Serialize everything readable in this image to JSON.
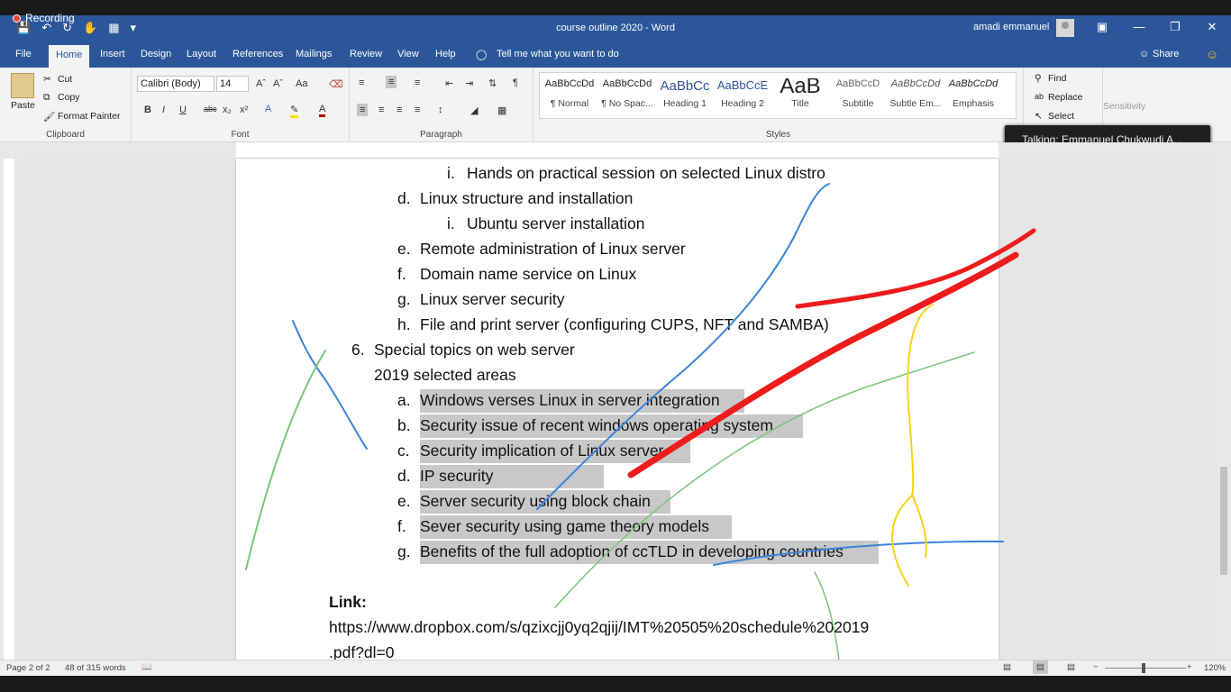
{
  "recording": {
    "label": "Recording"
  },
  "window": {
    "title": "course outline 2020  -  Word",
    "user": "amadi emmanuel"
  },
  "tabs": [
    "File",
    "Home",
    "Insert",
    "Design",
    "Layout",
    "References",
    "Mailings",
    "Review",
    "View",
    "Help"
  ],
  "tell_me": "Tell me what you want to do",
  "share": "Share",
  "clipboard": {
    "paste": "Paste",
    "cut": "Cut",
    "copy": "Copy",
    "format_painter": "Format Painter",
    "label": "Clipboard"
  },
  "font": {
    "name": "Calibri (Body)",
    "size": "14",
    "label": "Font"
  },
  "paragraph": {
    "label": "Paragraph"
  },
  "styles": {
    "label": "Styles",
    "items": [
      {
        "preview": "AaBbCcDd",
        "name": "¶ Normal"
      },
      {
        "preview": "AaBbCcDd",
        "name": "¶ No Spac..."
      },
      {
        "preview": "AaBbCc",
        "name": "Heading 1"
      },
      {
        "preview": "AaBbCcE",
        "name": "Heading 2"
      },
      {
        "preview": "AaB",
        "name": "Title"
      },
      {
        "preview": "AaBbCcD",
        "name": "Subtitle"
      },
      {
        "preview": "AaBbCcDd",
        "name": "Subtle Em..."
      },
      {
        "preview": "AaBbCcDd",
        "name": "Emphasis"
      }
    ]
  },
  "editing": {
    "find": "Find",
    "replace": "Replace",
    "select": "Select"
  },
  "sensitivity": "Sensitivity",
  "talking": "Talking:  Emmanuel  Chukwudi  A...",
  "document": {
    "lines": [
      {
        "marker": "i.",
        "text": "Hands on practical session on selected Linux distro"
      },
      {
        "marker": "d.",
        "text": "Linux structure and installation"
      },
      {
        "marker": "i.",
        "text": "Ubuntu server installation"
      },
      {
        "marker": "e.",
        "text": "Remote administration of Linux server"
      },
      {
        "marker": "f.",
        "text": "Domain name service on Linux"
      },
      {
        "marker": "g.",
        "text": "Linux server security"
      },
      {
        "marker": "h.",
        "text": "File and print server (configuring CUPS, NFT and SAMBA)"
      },
      {
        "marker": "6.",
        "text": "Special topics on web server"
      },
      {
        "marker": "",
        "text": "2019 selected areas"
      },
      {
        "marker": "a.",
        "text": "Windows verses Linux in server integration"
      },
      {
        "marker": "b.",
        "text": "Security issue of recent windows operating system"
      },
      {
        "marker": "c.",
        "text": "Security implication of Linux server"
      },
      {
        "marker": "d.",
        "text": "IP security"
      },
      {
        "marker": "e.",
        "text": "Server security using block chain"
      },
      {
        "marker": "f.",
        "text": "Sever security using game theory models"
      },
      {
        "marker": "g.",
        "text": "Benefits of the full adoption of ccTLD in developing countries"
      }
    ],
    "link_label": "Link:",
    "link_line1": "https://www.dropbox.com/s/qzixcjj0yq2qjij/IMT%20505%20schedule%202019",
    "link_line2": ".pdf?dl=0"
  },
  "statusbar": {
    "page": "Page 2 of 2",
    "words": "48 of 315 words",
    "zoom": "120%"
  }
}
